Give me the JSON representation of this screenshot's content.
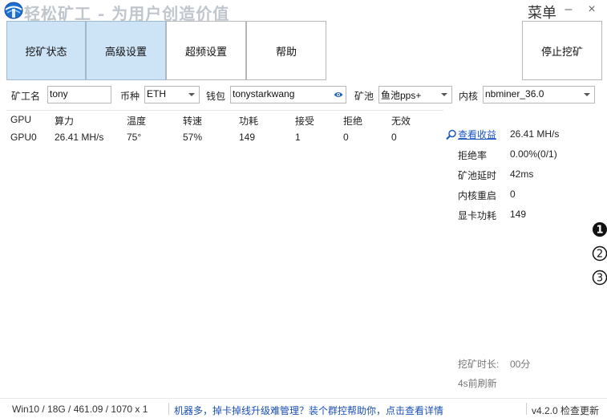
{
  "app": {
    "title": "轻松矿工 - 为用户创造价值",
    "menu_label": "菜单",
    "minimize_glyph": "–",
    "close_glyph": "×"
  },
  "toolbar": {
    "tabs": [
      {
        "label": "挖矿状态",
        "active": true
      },
      {
        "label": "高级设置",
        "active": true
      },
      {
        "label": "超频设置",
        "active": false
      },
      {
        "label": "帮助",
        "active": false
      }
    ],
    "stop_label": "停止挖矿"
  },
  "config": {
    "miner_name_label": "矿工名",
    "miner_name_value": "tony",
    "coin_label": "币种",
    "coin_value": "ETH",
    "wallet_label": "钱包",
    "wallet_value": "tonystarkwang",
    "pool_label": "矿池",
    "pool_value": "鱼池pps+",
    "kernel_label": "内核",
    "kernel_value": "nbminer_36.0"
  },
  "gpu_table": {
    "headers": [
      "GPU",
      "算力",
      "温度",
      "转速",
      "功耗",
      "接受",
      "拒绝",
      "无效"
    ],
    "rows": [
      [
        "GPU0",
        "26.41 MH/s",
        "75°",
        "57%",
        "149",
        "1",
        "0",
        "0"
      ]
    ]
  },
  "stats": {
    "view_earnings_label": "查看收益",
    "hashrate_value": "26.41 MH/s",
    "reject_rate_label": "拒绝率",
    "reject_rate_value": "0.00%(0/1)",
    "latency_label": "矿池延时",
    "latency_value": "42ms",
    "kernel_restart_label": "内核重启",
    "kernel_restart_value": "0",
    "card_power_label": "显卡功耗",
    "card_power_value": "149",
    "mining_time_label": "挖矿时长:",
    "mining_time_value": "00分",
    "refresh_text": "4s前刷新"
  },
  "badges": [
    "1",
    "2",
    "3"
  ],
  "statusbar": {
    "system_info": "Win10  / 18G / 461.09 / 1070 x 1",
    "promo_text": "机器多，掉卡掉线升级难管理？装个群控帮助你，点击查看详情",
    "version_text": "v4.2.0 检查更新"
  },
  "colors": {
    "active_tab_bg": "#cde4f7",
    "link": "#1a56c6",
    "title_text": "#bfc6cd"
  }
}
